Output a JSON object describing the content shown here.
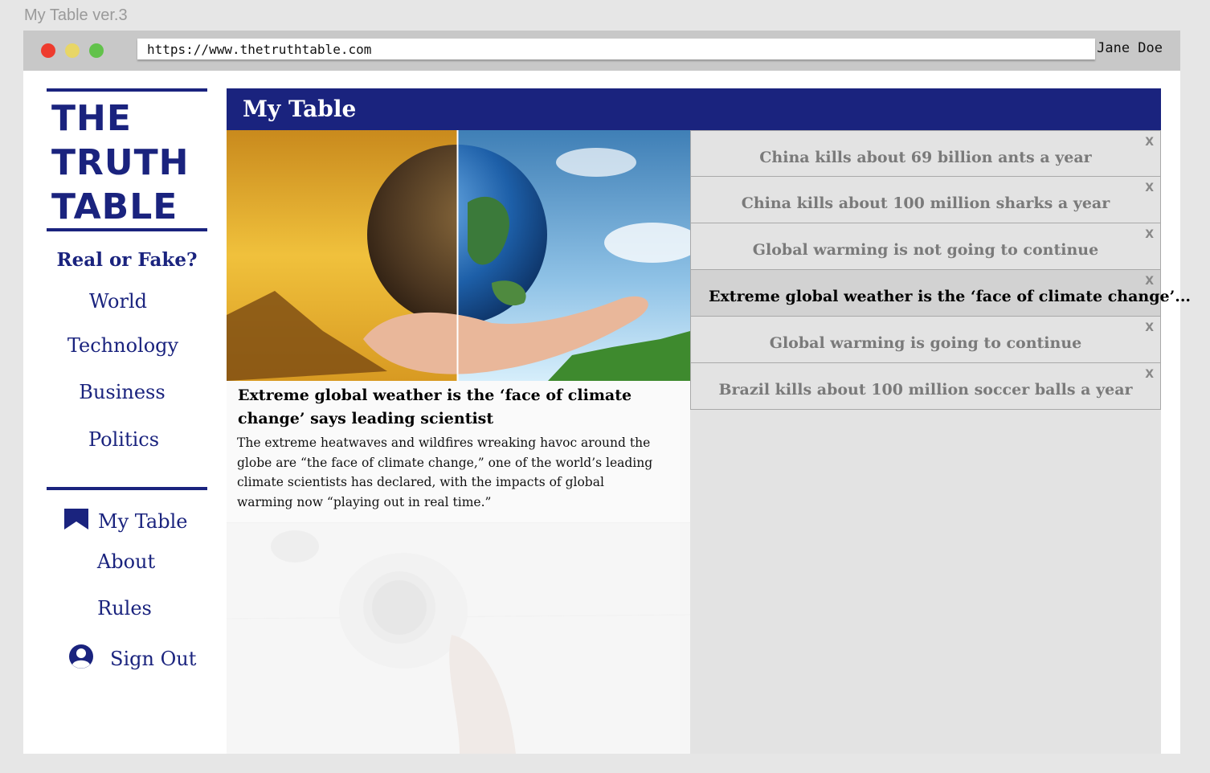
{
  "window": {
    "title": "My Table ver.3"
  },
  "browser": {
    "url": "https://www.thetruthtable.com",
    "user_name": "Jane Doe"
  },
  "logo": {
    "lines": [
      "THE",
      "TRUTH",
      "TABLE"
    ]
  },
  "sidebar": {
    "heading": "Real or Fake?",
    "categories": [
      "World",
      "Technology",
      "Business",
      "Politics"
    ],
    "my_table": "My Table",
    "about": "About",
    "rules": "Rules",
    "sign_out": "Sign Out"
  },
  "main": {
    "title": "My Table",
    "article": {
      "headline": "Extreme global weather is the ‘face of climate change’ says leading scientist",
      "body": "The extreme heatwaves and wildfires wreaking havoc around the globe are “the face of climate change,” one of the world’s leading climate scientists has declared, with the impacts of global warming now “playing out in real time.”"
    },
    "saved_items": [
      {
        "label": "China kills about 69 billion ants a year",
        "close": "X"
      },
      {
        "label": "China kills about 100 million sharks a year",
        "close": "X"
      },
      {
        "label": "Global warming is not going to continue",
        "close": "X"
      },
      {
        "label": "Extreme global weather is the ‘face of climate change’...",
        "close": "X"
      },
      {
        "label": "Global warming is going to continue",
        "close": "X"
      },
      {
        "label": "Brazil kills about 100 million soccer balls a year",
        "close": "X"
      }
    ]
  },
  "colors": {
    "brand": "#1a237e",
    "active_item": "#d2d2d2"
  },
  "icons": [
    "bookmark-icon",
    "user-avatar-icon",
    "close-icon"
  ]
}
